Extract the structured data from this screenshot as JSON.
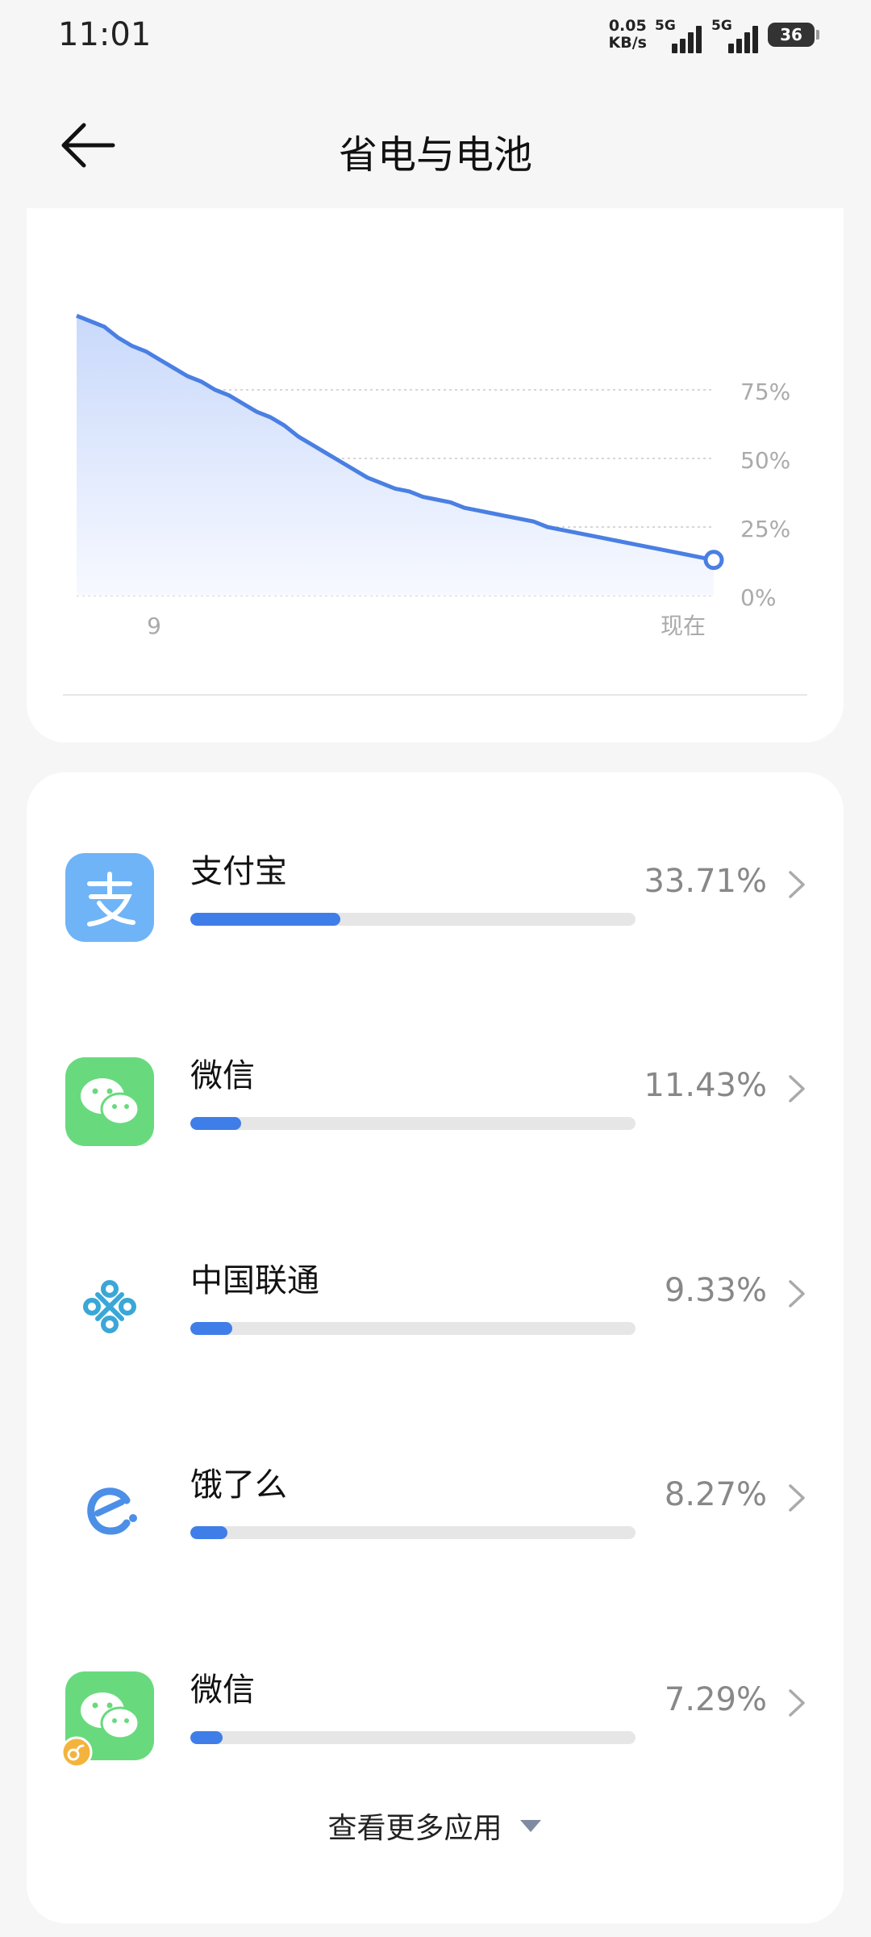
{
  "status_bar": {
    "time": "11:01",
    "net_speed_value": "0.05",
    "net_speed_unit": "KB/s",
    "signal1_label": "5G",
    "signal2_label": "5G",
    "battery": "36"
  },
  "header": {
    "title": "省电与电池"
  },
  "chart_data": {
    "type": "area",
    "y_ticks": [
      "75%",
      "50%",
      "25%",
      "0%"
    ],
    "x_ticks": [
      "9",
      "现在"
    ],
    "ylim": [
      0,
      100
    ],
    "grid": true,
    "values": [
      102,
      100,
      98,
      94,
      91,
      89,
      86,
      83,
      80,
      78,
      75,
      73,
      70,
      67,
      65,
      62,
      58,
      55,
      52,
      49,
      46,
      43,
      41,
      39,
      38,
      36,
      35,
      34,
      32,
      31,
      30,
      29,
      28,
      27,
      25,
      24,
      23,
      22,
      21,
      20,
      19,
      18,
      17,
      16,
      15,
      14,
      13
    ]
  },
  "apps": [
    {
      "name": "支付宝",
      "percent": "33.71%",
      "share": 33.71,
      "icon": "alipay-icon"
    },
    {
      "name": "微信",
      "percent": "11.43%",
      "share": 11.43,
      "icon": "wechat-icon"
    },
    {
      "name": "中国联通",
      "percent": "9.33%",
      "share": 9.33,
      "icon": "china-unicom-icon"
    },
    {
      "name": "饿了么",
      "percent": "8.27%",
      "share": 8.27,
      "icon": "eleme-icon"
    },
    {
      "name": "微信",
      "percent": "7.29%",
      "share": 7.29,
      "icon": "wechat-clone-icon"
    }
  ],
  "more_apps_label": "查看更多应用",
  "colors": {
    "accent": "#3f7ee8",
    "alipay": "#6fb4f6",
    "wechat": "#68da7d",
    "unicom": "#3aa7d7"
  }
}
